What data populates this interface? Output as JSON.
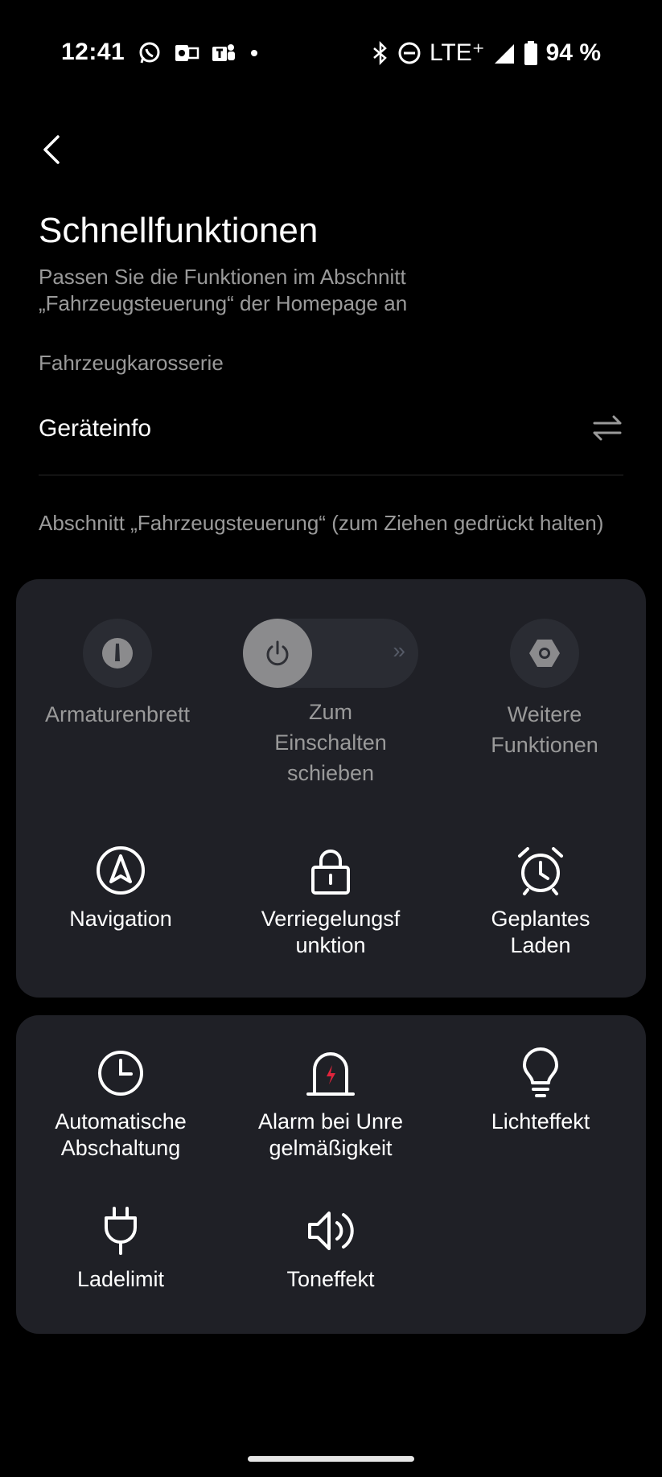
{
  "status_bar": {
    "time": "12:41",
    "network": "LTE⁺",
    "battery": "94 %"
  },
  "header": {
    "back_icon": "chevron-left-icon",
    "title": "Schnellfunktionen",
    "subtitle": "Passen Sie die Funktionen im Abschnitt „Fahrzeugsteuerung“ der Homepage an"
  },
  "body_section": {
    "label": "Fahrzeugkarosserie",
    "device_row": "Geräteinfo",
    "swap_icon": "swap-arrows-icon"
  },
  "control_section": {
    "label": "Abschnitt „Fahrzeugsteuerung“ (zum Ziehen gedrückt halten)"
  },
  "card1": {
    "dashboard": "Armaturenbrett",
    "slider_label_1": "Zum",
    "slider_label_2": "Einschalten",
    "slider_label_3": "schieben",
    "slider_chevrons": "»",
    "more_1": "Weitere",
    "more_2": "Funktionen",
    "navigation": "Navigation",
    "lock_1": "Verriegelungsf",
    "lock_2": "unktion",
    "scheduled_1": "Geplantes",
    "scheduled_2": "Laden"
  },
  "card2": {
    "autooff_1": "Automatische",
    "autooff_2": "Abschaltung",
    "alarm_1": "Alarm bei Unre",
    "alarm_2": "gelmäßigkeit",
    "light": "Lichteffekt",
    "chargelimit": "Ladelimit",
    "sound": "Toneffekt"
  },
  "colors": {
    "background": "#000000",
    "card": "#1f2026",
    "muted_text": "#9a9a9a",
    "alarm_accent": "#e0243c"
  }
}
